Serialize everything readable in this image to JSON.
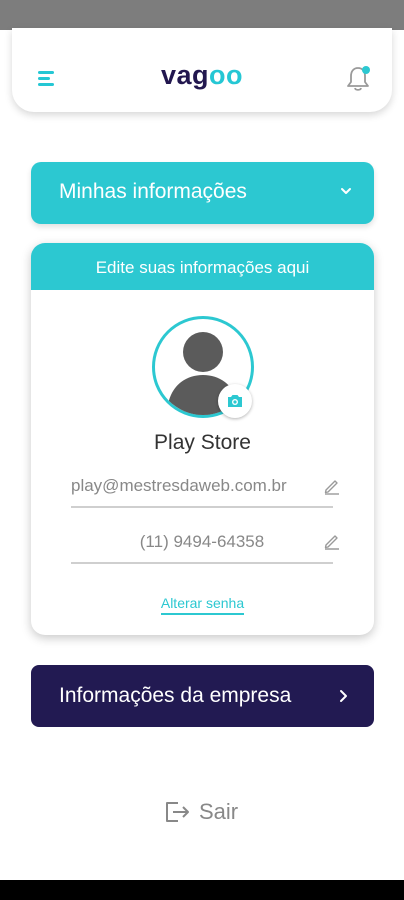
{
  "app": {
    "logo_prefix": "vag",
    "logo_accent": "oo"
  },
  "colors": {
    "teal": "#2cc8d1",
    "navy": "#221a52",
    "logo_navy": "#22174f",
    "muted_text": "#888888"
  },
  "icons": {
    "menu": "menu-icon",
    "notification": "bell-icon",
    "camera": "camera-icon",
    "edit": "pencil-icon",
    "expand": "chevron-down-icon",
    "open": "chevron-right-icon",
    "logout": "logout-icon"
  },
  "sections": {
    "my_info": {
      "label": "Minhas informações"
    },
    "company": {
      "label": "Informações da empresa"
    }
  },
  "profile": {
    "card_title": "Edite suas informações aqui",
    "name": "Play Store",
    "email": "play@mestresdaweb.com.br",
    "phone": "(11) 9494-64358",
    "change_password": "Alterar senha"
  },
  "logout": {
    "label": "Sair"
  }
}
